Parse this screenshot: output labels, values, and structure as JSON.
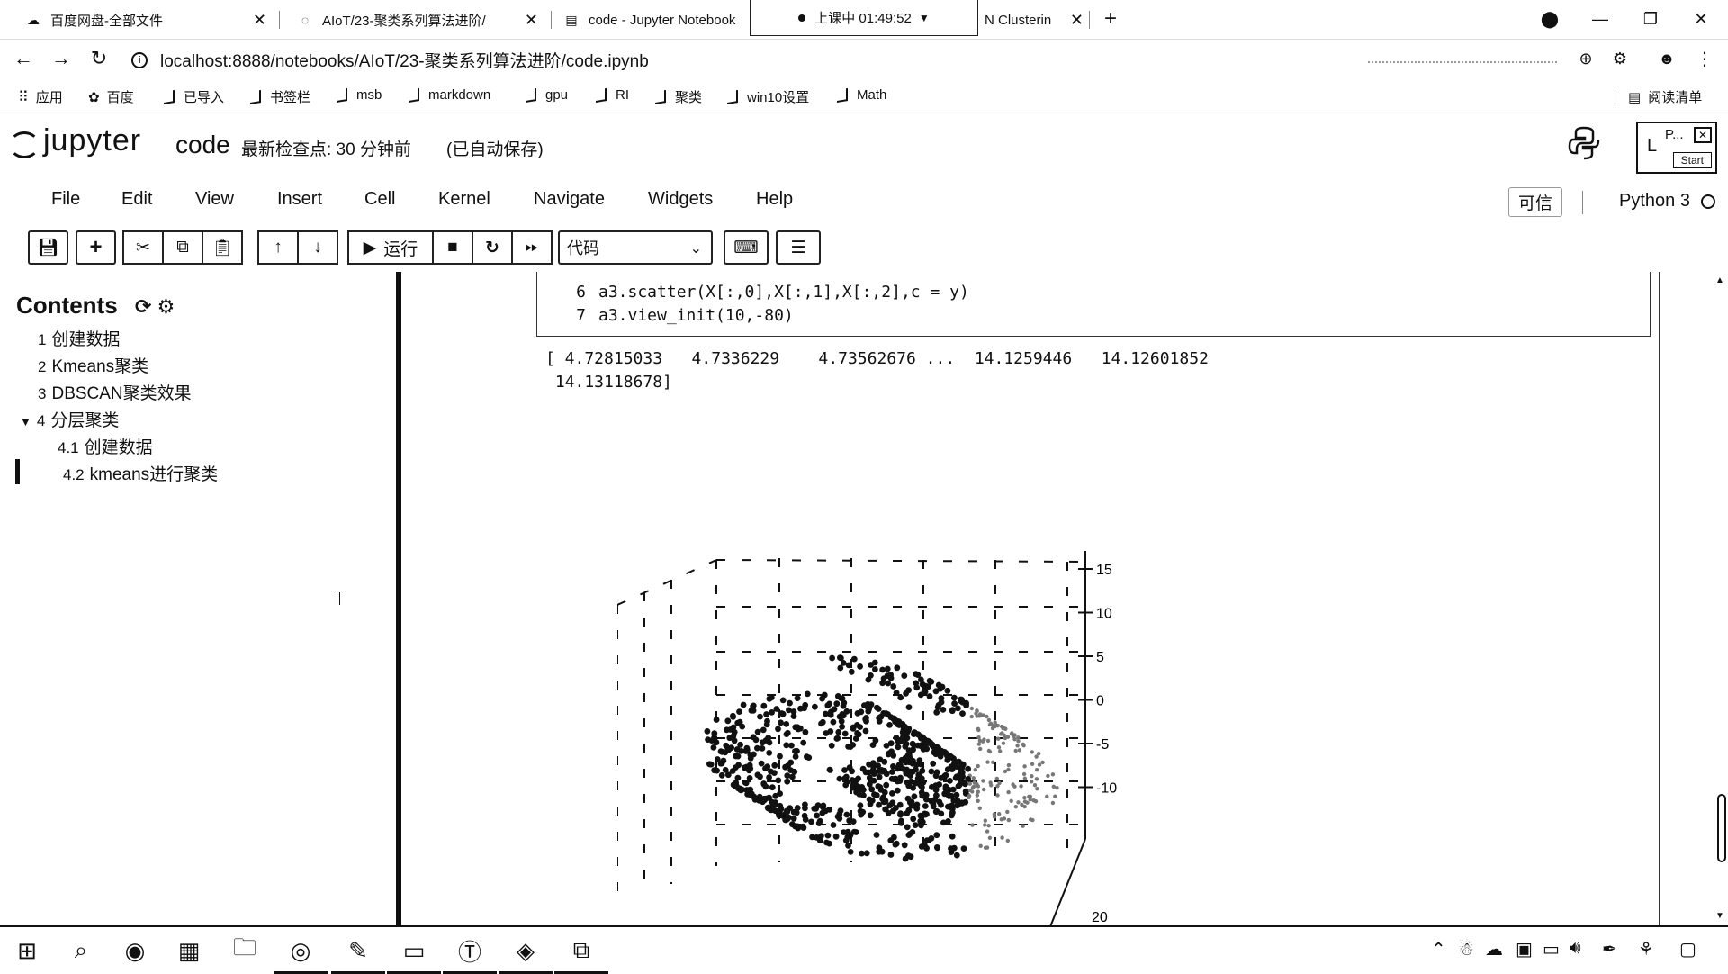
{
  "browser": {
    "tabs": [
      {
        "title": "百度网盘-全部文件",
        "icon": "baidu-netdisk-icon"
      },
      {
        "title": "AIoT/23-聚类系列算法进阶/",
        "icon": "loading-icon"
      },
      {
        "title": "code - Jupyter Notebook",
        "icon": "notebook-icon"
      },
      {
        "title": "N Clusterin",
        "icon": ""
      }
    ],
    "recording_text": "上课中 01:49:52",
    "url": "localhost:8888/notebooks/AIoT/23-聚类系列算法进阶/code.ipynb",
    "bookmarks": [
      "应用",
      "百度",
      "已导入",
      "书签栏",
      "msb",
      "markdown",
      "gpu",
      "RI",
      "聚类",
      "win10设置",
      "Math"
    ],
    "reading_list": "阅读清单"
  },
  "jupyter": {
    "logo_text": "jupyter",
    "notebook_name": "code",
    "checkpoint": "最新检查点: 30 分钟前",
    "autosave": "(已自动保存)",
    "popup": {
      "l": "L",
      "p": "P...",
      "start": "Start"
    },
    "menu": [
      "File",
      "Edit",
      "View",
      "Insert",
      "Cell",
      "Kernel",
      "Navigate",
      "Widgets",
      "Help"
    ],
    "trusted": "可信",
    "kernel_name": "Python 3",
    "toolbar": {
      "run_label": "运行",
      "cell_type": "代码"
    }
  },
  "toc": {
    "title": "Contents",
    "items": [
      {
        "num": "1",
        "label": "创建数据"
      },
      {
        "num": "2",
        "label": "Kmeans聚类"
      },
      {
        "num": "3",
        "label": "DBSCAN聚类效果"
      },
      {
        "num": "4",
        "label": "分层聚类"
      },
      {
        "num": "4.1",
        "label": "创建数据"
      },
      {
        "num": "4.2",
        "label": "kmeans进行聚类"
      }
    ]
  },
  "cell": {
    "lines": [
      {
        "n": "6",
        "code": "a3.scatter(X[:,0],X[:,1],X[:,2],c = y)"
      },
      {
        "n": "7",
        "code": "a3.view_init(10,-80)"
      }
    ],
    "output": "[ 4.72815033   4.7336229    4.73562676 ...  14.1259446   14.12601852\n 14.13118678]"
  },
  "chart_data": {
    "type": "scatter",
    "title": "",
    "zlabel": "",
    "z_ticks": [
      "15",
      "10",
      "5",
      "0",
      "-5",
      "-10"
    ],
    "y_ticks_visible": [
      "20"
    ],
    "view": {
      "elev": 10,
      "azim": -80
    }
  }
}
